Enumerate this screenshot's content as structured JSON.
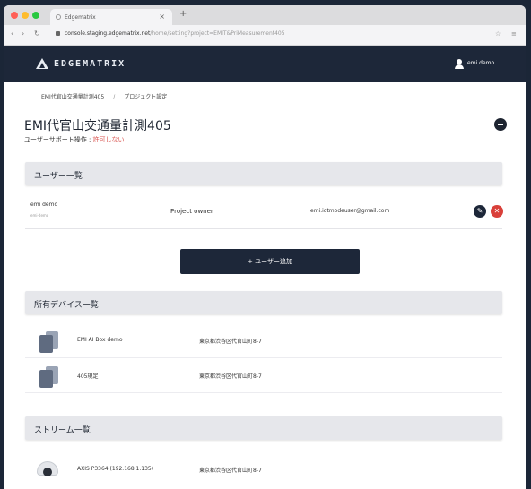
{
  "browser": {
    "tab_title": "Edgematrix",
    "tab_close": "×",
    "new_tab": "+",
    "url_host": "console.staging.edgematrix.net",
    "url_path": "/home/setting?project=EMIT&PriMeasurement405"
  },
  "header": {
    "logo_text": "EDGEMATRIX",
    "user_name": "emi demo"
  },
  "breadcrumb": {
    "project": "EMI代官山交通量計測405",
    "separator": "/",
    "current": "プロジェクト設定"
  },
  "project": {
    "title": "EMI代官山交通量計測405",
    "support_label": "ユーザーサポート操作 : ",
    "support_value": "許可しない"
  },
  "users_section": {
    "title": "ユーザー一覧",
    "users": [
      {
        "name": "emi demo",
        "sub": "emi-demo",
        "role": "Project owner",
        "email": "emi.iotmodeuser@gmail.com"
      }
    ],
    "edit_icon": "✎",
    "delete_icon": "✕",
    "add_button": "+ ユーザー追加"
  },
  "devices_section": {
    "title": "所有デバイス一覧",
    "devices": [
      {
        "name": "EMI AI Box demo",
        "address": "東京都渋谷区代官山町8-7"
      },
      {
        "name": "405現定",
        "address": "東京都渋谷区代官山町8-7"
      }
    ]
  },
  "streams_section": {
    "title": "ストリーム一覧",
    "streams": [
      {
        "name": "AXIS P3364 (192.168.1.135)",
        "address": "東京都渋谷区代官山町8-7"
      }
    ]
  },
  "colors": {
    "header_bg": "#1d2739",
    "accent_dark": "#1d2739",
    "danger": "#d9403a",
    "section_bg": "#e6e7eb"
  }
}
